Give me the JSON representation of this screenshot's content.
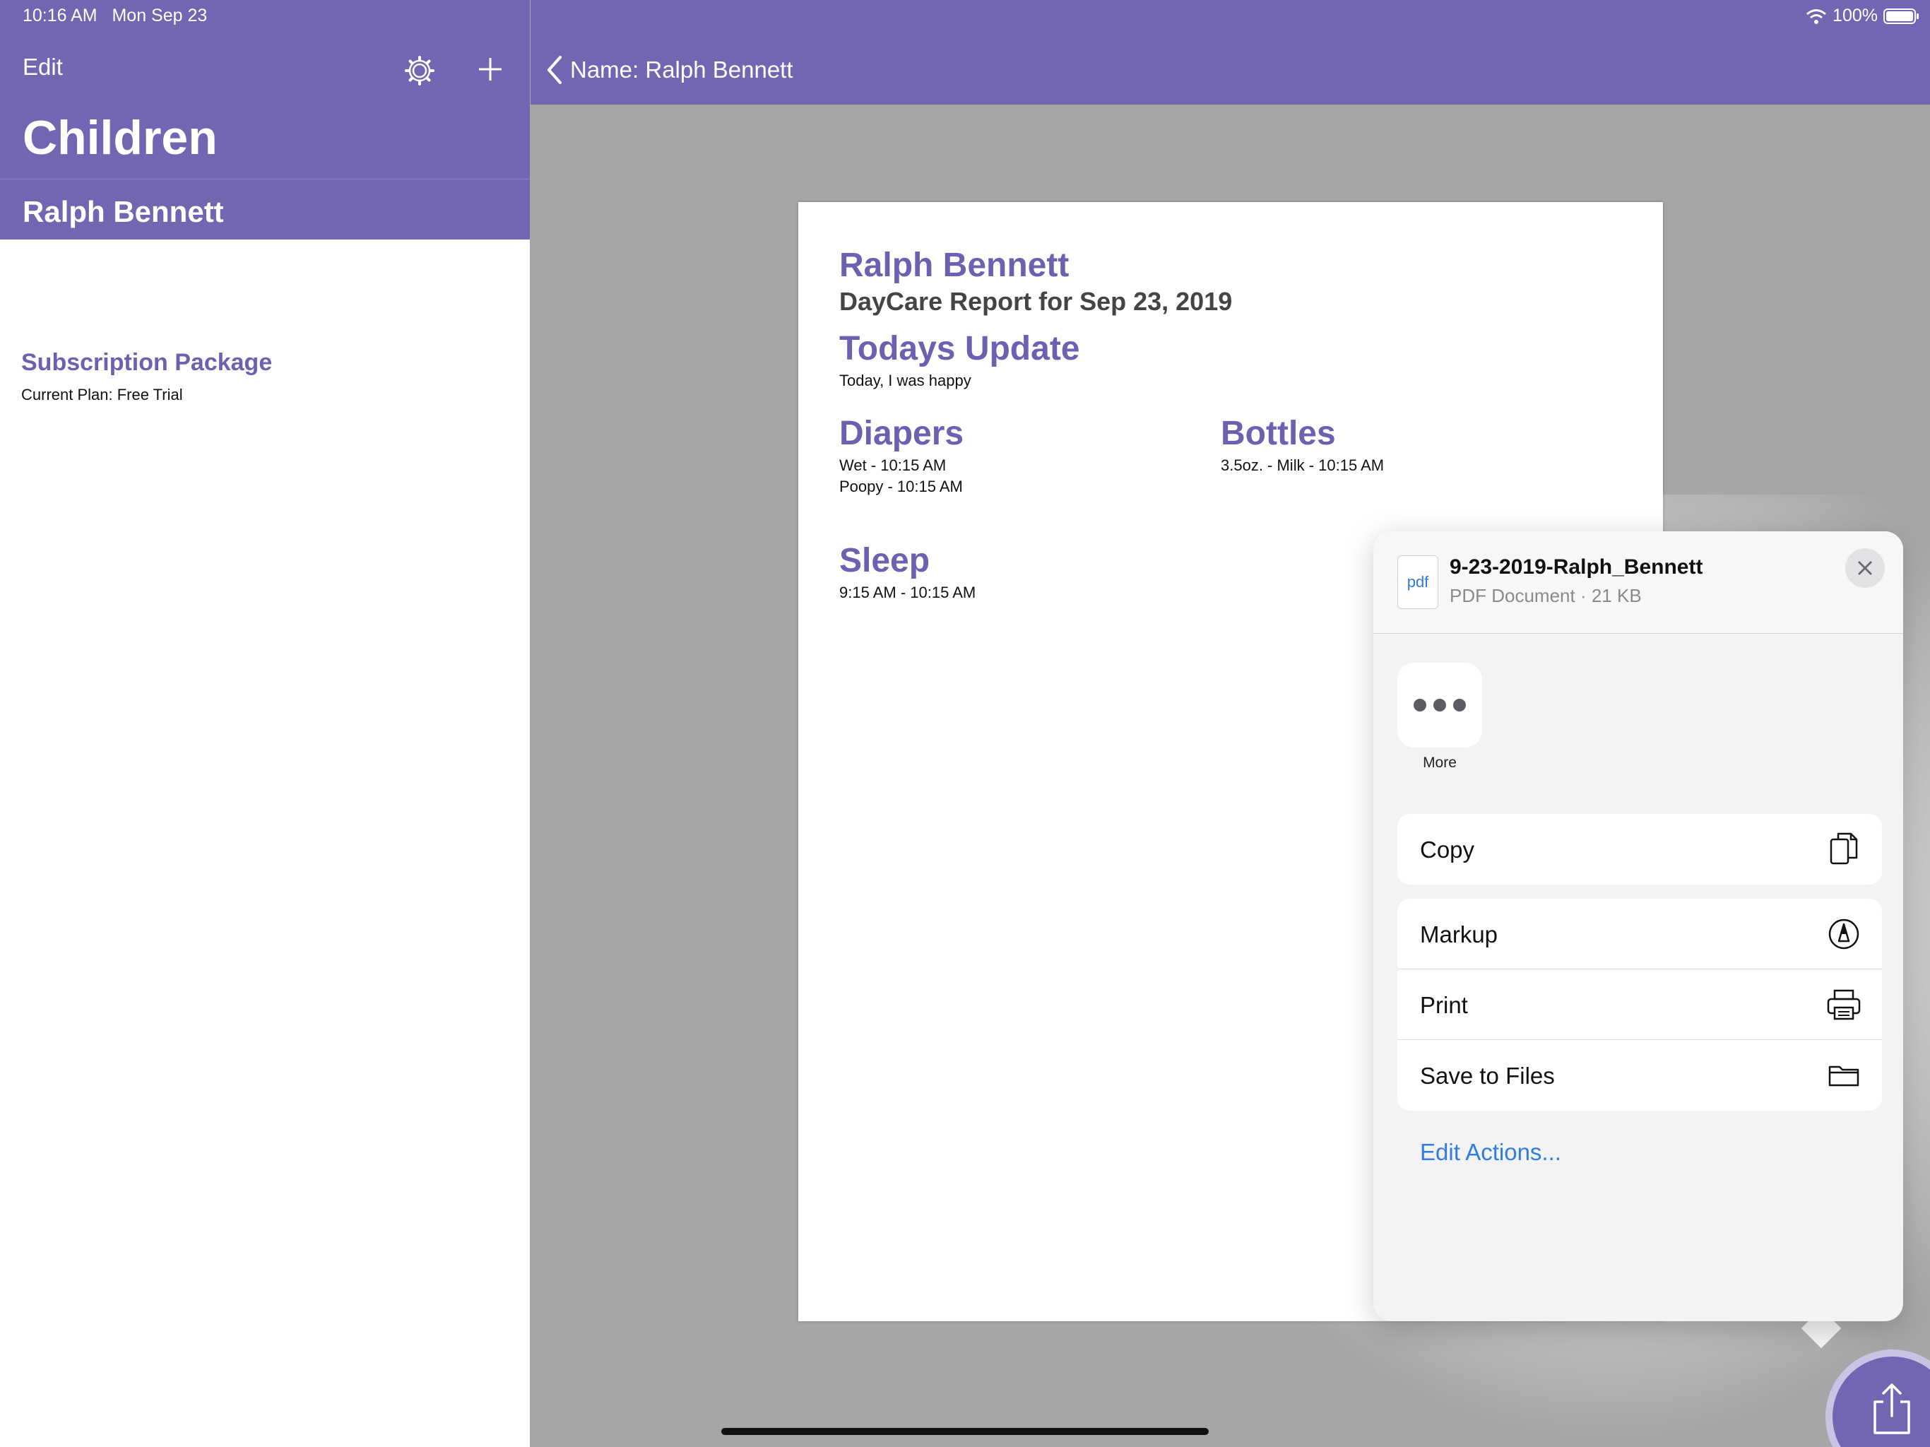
{
  "status": {
    "time_date": "10:16 AM   Mon Sep 23",
    "battery": "100%"
  },
  "sidebar": {
    "edit_label": "Edit",
    "title": "Children",
    "selected_child": "Ralph Bennett",
    "subscription_title": "Subscription Package",
    "subscription_plan": "Current Plan: Free Trial"
  },
  "detail": {
    "back_label": "Name: Ralph Bennett"
  },
  "document": {
    "name": "Ralph Bennett",
    "subtitle": "DayCare Report for Sep 23, 2019",
    "today_heading": "Todays Update",
    "today_text": "Today, I was happy",
    "diapers_heading": "Diapers",
    "diapers": [
      "Wet - 10:15 AM",
      "Poopy - 10:15 AM"
    ],
    "bottles_heading": "Bottles",
    "bottles": [
      "3.5oz. - Milk - 10:15 AM"
    ],
    "sleep_heading": "Sleep",
    "sleep_text": "9:15 AM - 10:15 AM"
  },
  "share_sheet": {
    "file_icon_text": "pdf",
    "file_name": "9-23-2019-Ralph_Bennett",
    "file_meta": "PDF Document · 21 KB",
    "more_label": "More",
    "actions": [
      {
        "label": "Copy",
        "icon": "copy-icon"
      },
      {
        "label": "Markup",
        "icon": "markup-icon"
      },
      {
        "label": "Print",
        "icon": "printer-icon"
      },
      {
        "label": "Save to Files",
        "icon": "folder-icon"
      }
    ],
    "edit_actions_label": "Edit Actions..."
  },
  "colors": {
    "brand": "#7465b3",
    "link": "#2f7de1"
  }
}
